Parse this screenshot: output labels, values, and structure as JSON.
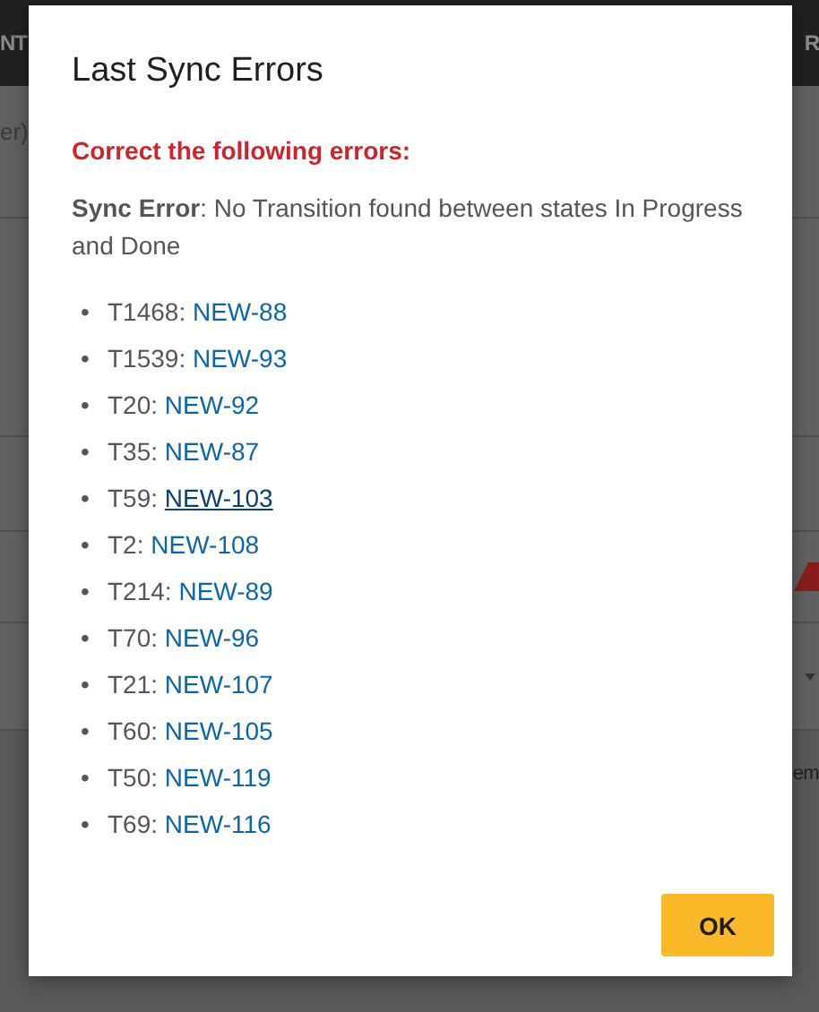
{
  "background": {
    "header_left": "NT",
    "header_right": "R",
    "row_text_left": "er)",
    "row_text_right": "em"
  },
  "dialog": {
    "title": "Last Sync Errors",
    "error_heading": "Correct the following errors:",
    "message": "**Sync Error**: No Transition found between states In Progress and Done",
    "bullet": "•",
    "items": [
      {
        "task": "T1468:",
        "link": "NEW-88",
        "hovered": false
      },
      {
        "task": "T1539:",
        "link": "NEW-93",
        "hovered": false
      },
      {
        "task": "T20:",
        "link": "NEW-92",
        "hovered": false
      },
      {
        "task": "T35:",
        "link": "NEW-87",
        "hovered": false
      },
      {
        "task": "T59:",
        "link": "NEW-103",
        "hovered": true
      },
      {
        "task": "T2:",
        "link": "NEW-108",
        "hovered": false
      },
      {
        "task": "T214:",
        "link": "NEW-89",
        "hovered": false
      },
      {
        "task": "T70:",
        "link": "NEW-96",
        "hovered": false
      },
      {
        "task": "T21:",
        "link": "NEW-107",
        "hovered": false
      },
      {
        "task": "T60:",
        "link": "NEW-105",
        "hovered": false
      },
      {
        "task": "T50:",
        "link": "NEW-119",
        "hovered": false
      },
      {
        "task": "T69:",
        "link": "NEW-116",
        "hovered": false
      }
    ],
    "button": "OK"
  }
}
